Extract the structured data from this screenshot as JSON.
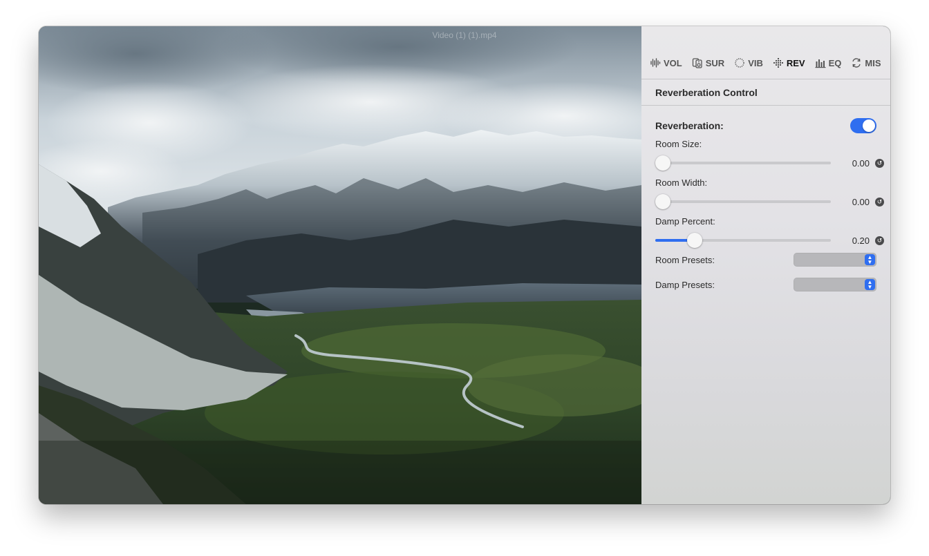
{
  "window": {
    "title": "Video (1) (1).mp4"
  },
  "tabs": [
    {
      "label": "VOL",
      "icon": "waveform-icon",
      "active": false
    },
    {
      "label": "SUR",
      "icon": "surround-speaker-icon",
      "active": false
    },
    {
      "label": "VIB",
      "icon": "vibrato-ring-icon",
      "active": false
    },
    {
      "label": "REV",
      "icon": "reverb-dots-icon",
      "active": true
    },
    {
      "label": "EQ",
      "icon": "equalizer-bars-icon",
      "active": false
    },
    {
      "label": "MIS",
      "icon": "misc-cycle-icon",
      "active": false
    }
  ],
  "panel": {
    "title": "Reverberation Control",
    "reverb_label": "Reverberation:",
    "reverb_enabled": true,
    "room_size": {
      "label": "Room Size:",
      "value": "0.00",
      "fraction": 0.0
    },
    "room_width": {
      "label": "Room Width:",
      "value": "0.00",
      "fraction": 0.0
    },
    "damp_percent": {
      "label": "Damp Percent:",
      "value": "0.20",
      "fraction": 0.2
    },
    "room_presets": {
      "label": "Room Presets:",
      "selected": ""
    },
    "damp_presets": {
      "label": "Damp Presets:",
      "selected": ""
    }
  },
  "colors": {
    "accent": "#2f6ef0",
    "panel_bg": "#e5e4e7"
  }
}
